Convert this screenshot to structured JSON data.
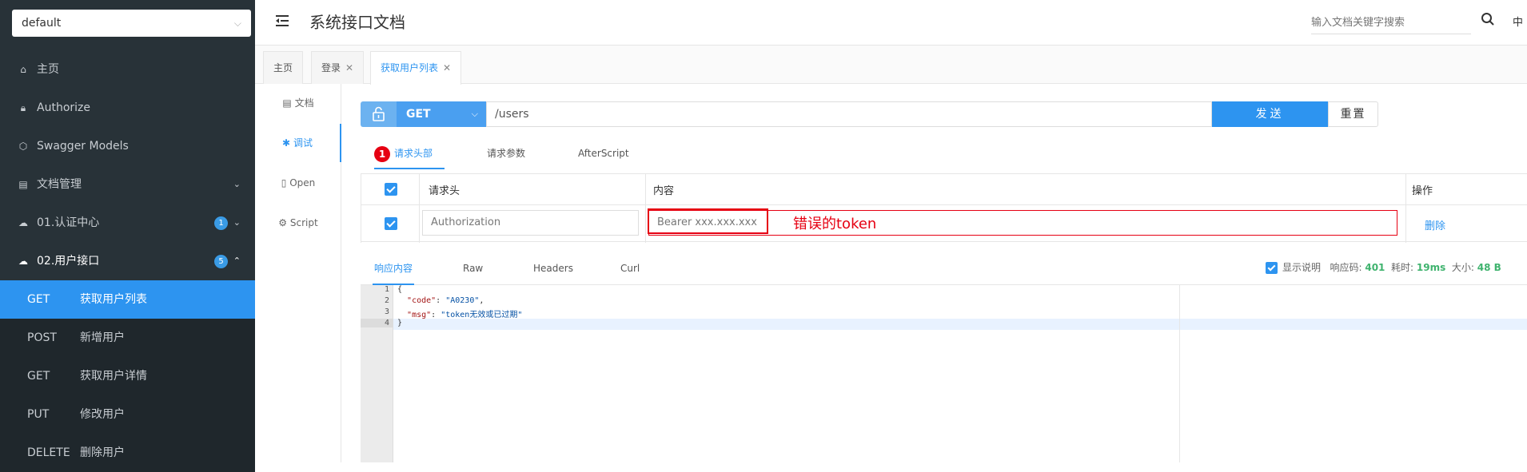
{
  "sidebar": {
    "project_select": "default",
    "menu": [
      {
        "label": "主页",
        "icon": "home-icon"
      },
      {
        "label": "Authorize",
        "icon": "lock-icon"
      },
      {
        "label": "Swagger Models",
        "icon": "cube-icon"
      },
      {
        "label": "文档管理",
        "icon": "doc-icon"
      },
      {
        "label": "01.认证中心",
        "icon": "cloud-icon",
        "count": "1"
      },
      {
        "label": "02.用户接口",
        "icon": "cloud-icon",
        "count": "5"
      }
    ],
    "endpoints": [
      {
        "method": "GET",
        "label": "获取用户列表"
      },
      {
        "method": "POST",
        "label": "新增用户"
      },
      {
        "method": "GET",
        "label": "获取用户详情"
      },
      {
        "method": "PUT",
        "label": "修改用户"
      },
      {
        "method": "DELETE",
        "label": "删除用户"
      }
    ]
  },
  "header": {
    "title": "系统接口文档",
    "search_placeholder": "输入文档关键字搜索",
    "lang": "中"
  },
  "page_tabs": [
    {
      "label": "主页"
    },
    {
      "label": "登录"
    },
    {
      "label": "获取用户列表"
    }
  ],
  "left_nav": [
    {
      "label": "文档"
    },
    {
      "label": "调试"
    },
    {
      "label": "Open"
    },
    {
      "label": "Script"
    }
  ],
  "request": {
    "method": "GET",
    "url": "/users",
    "send_label": "发送",
    "reset_label": "重置"
  },
  "request_tabs": {
    "badge": "1",
    "headers": "请求头部",
    "params": "请求参数",
    "after": "AfterScript"
  },
  "header_table": {
    "col_name": "请求头",
    "col_value": "内容",
    "col_action": "操作",
    "row_name": "Authorization",
    "row_value": "Bearer xxx.xxx.xxx",
    "row_action": "删除"
  },
  "annotation": "错误的token",
  "response_tabs": {
    "content": "响应内容",
    "raw": "Raw",
    "headers": "Headers",
    "curl": "Curl"
  },
  "response_info": {
    "show_desc": "显示说明",
    "code_label": "响应码:",
    "code": "401",
    "time_label": "耗时:",
    "time": "19ms",
    "size_label": "大小:",
    "size": "48 B"
  },
  "response_body": {
    "line_numbers": [
      "1",
      "2",
      "3",
      "4"
    ],
    "open": "{",
    "key1": "\"code\"",
    "val1": "\"A0230\"",
    "key2": "\"msg\"",
    "val2": "\"token无效或已过期\"",
    "close": "}"
  },
  "colors": {
    "primary": "#2d94f0",
    "sidebar_bg": "#283238",
    "error": "#e60012",
    "success": "#3fb36e"
  }
}
